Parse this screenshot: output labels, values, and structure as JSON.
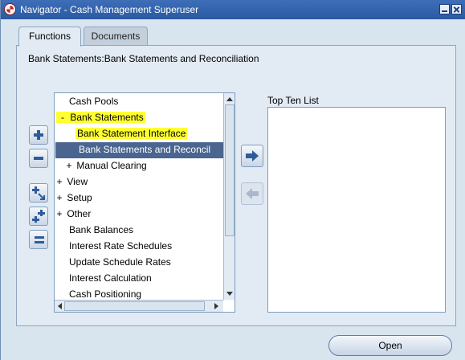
{
  "window": {
    "title": "Navigator - Cash Management Superuser"
  },
  "tabs": [
    {
      "label": "Functions",
      "active": true
    },
    {
      "label": "Documents",
      "active": false
    }
  ],
  "breadcrumb": "Bank Statements:Bank Statements and Reconciliation",
  "tree": {
    "items": [
      {
        "label": "Cash Pools",
        "prefix": ""
      },
      {
        "label": "Bank Statements",
        "prefix": "-",
        "highlighted": true
      },
      {
        "label": "Bank Statement Interface",
        "prefix": "",
        "highlighted": true
      },
      {
        "label": "Bank Statements and Reconcil",
        "prefix": "",
        "selected": true
      },
      {
        "label": "Manual Clearing",
        "prefix": "+"
      },
      {
        "label": "View",
        "prefix": "+"
      },
      {
        "label": "Setup",
        "prefix": "+"
      },
      {
        "label": "Other",
        "prefix": "+"
      },
      {
        "label": "Bank Balances",
        "prefix": ""
      },
      {
        "label": "Interest Rate Schedules",
        "prefix": ""
      },
      {
        "label": "Update Schedule Rates",
        "prefix": ""
      },
      {
        "label": "Interest Calculation",
        "prefix": ""
      },
      {
        "label": "Cash Positioning",
        "prefix": ""
      }
    ]
  },
  "top_ten": {
    "label": "Top Ten List",
    "items": []
  },
  "buttons": {
    "open": "Open"
  },
  "colors": {
    "title_bar": "#2B5AA3",
    "highlight": "#FFFF33",
    "selection": "#4A6690",
    "panel": "#E2EAF3"
  }
}
